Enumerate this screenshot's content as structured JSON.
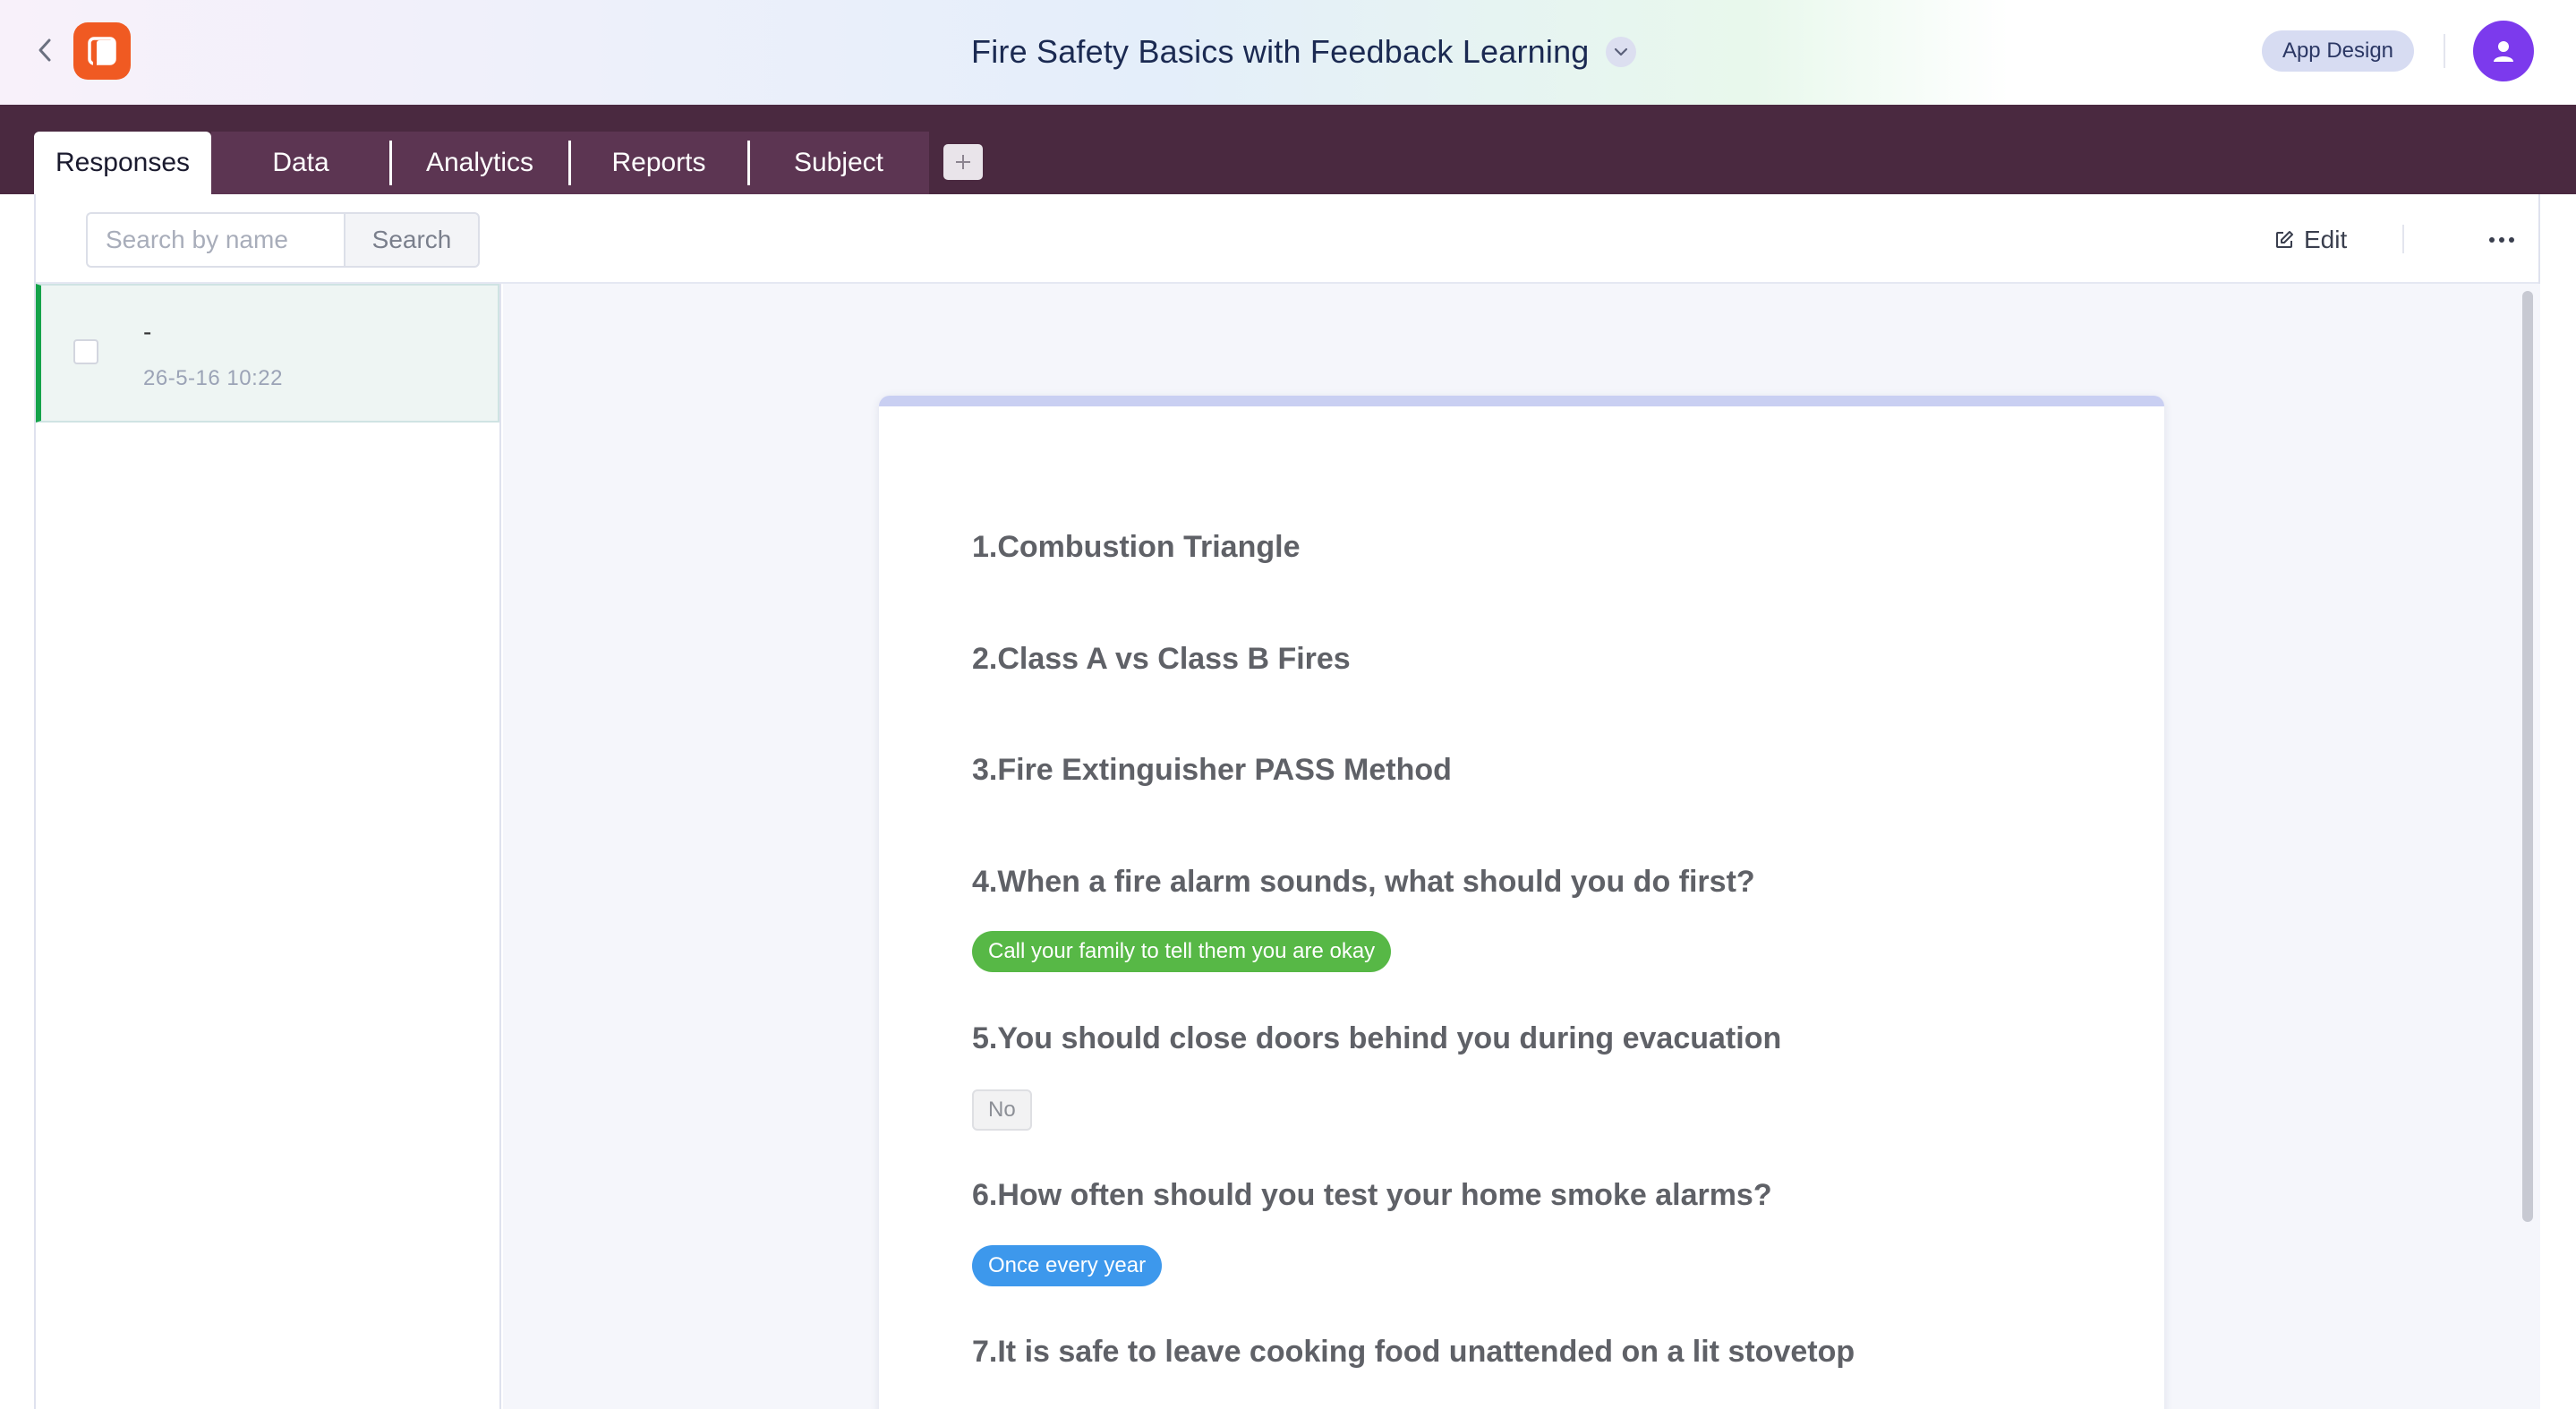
{
  "header": {
    "title": "Fire Safety Basics with Feedback Learning",
    "app_design_label": "App Design"
  },
  "tabs": [
    {
      "label": "Responses",
      "active": true
    },
    {
      "label": "Data"
    },
    {
      "label": "Analytics"
    },
    {
      "label": "Reports"
    },
    {
      "label": "Subject"
    }
  ],
  "toolbar": {
    "search_placeholder": "Search by name",
    "search_button": "Search",
    "edit_label": "Edit"
  },
  "responses": [
    {
      "name": "-",
      "time": "26-5-16 10:22"
    }
  ],
  "questions": [
    {
      "text": "1.Combustion Triangle"
    },
    {
      "text": "2.Class A vs Class B Fires"
    },
    {
      "text": "3.Fire Extinguisher PASS Method"
    },
    {
      "text": "4.When a fire alarm sounds, what should you do first?",
      "answer": "Call your family to tell them you are okay",
      "answer_style": "green"
    },
    {
      "text": "5.You should close doors behind you during evacuation",
      "answer": "No",
      "answer_style": "gray"
    },
    {
      "text": "6.How often should you test your home smoke alarms?",
      "answer": "Once every year",
      "answer_style": "blue"
    },
    {
      "text": "7.It is safe to leave cooking food unattended on a lit stovetop"
    }
  ],
  "colors": {
    "tabbar": "#4a2940",
    "logo": "#f05a22",
    "avatar": "#7c3aed",
    "selected_accent": "#15a34a",
    "pill_green": "#57b846",
    "pill_blue": "#3d98ec"
  },
  "icons": {
    "back": "chevron-left-icon",
    "logo": "app-logo-icon",
    "title_dropdown": "chevron-down-icon",
    "avatar": "user-icon",
    "add_tab": "plus-icon",
    "edit": "edit-icon",
    "more": "more-horizontal-icon"
  }
}
